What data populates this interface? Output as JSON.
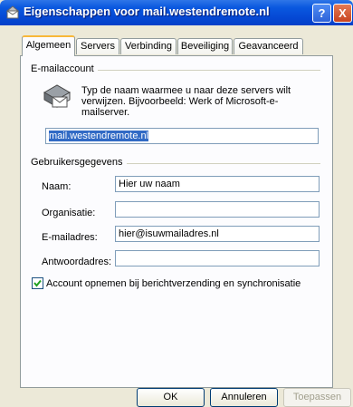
{
  "window": {
    "title": "Eigenschappen voor mail.westendremote.nl",
    "help_label": "?",
    "close_label": "X",
    "icon": "mail-properties-icon"
  },
  "tabs": [
    {
      "label": "Algemeen",
      "active": true
    },
    {
      "label": "Servers"
    },
    {
      "label": "Verbinding"
    },
    {
      "label": "Beveiliging"
    },
    {
      "label": "Geavanceerd"
    }
  ],
  "email_account": {
    "group_label": "E-mailaccount",
    "description": "Typ de naam waarmee u naar deze servers wilt verwijzen. Bijvoorbeeld: Werk of Microsoft-e-mailserver.",
    "account_name": "mail.westendremote.nl",
    "icon": "mail-account-icon"
  },
  "user_info": {
    "group_label": "Gebruikersgegevens",
    "name_label": "Naam:",
    "name_value": "Hier uw naam",
    "organization_label": "Organisatie:",
    "organization_value": "",
    "email_label": "E-mailadres:",
    "email_value": "hier@isuwmailadres.nl",
    "reply_label": "Antwoordadres:",
    "reply_value": ""
  },
  "include_account": {
    "label": "Account opnemen bij berichtverzending en synchronisatie",
    "checked": true
  },
  "buttons": {
    "ok": "OK",
    "cancel": "Annuleren",
    "apply": "Toepassen"
  }
}
